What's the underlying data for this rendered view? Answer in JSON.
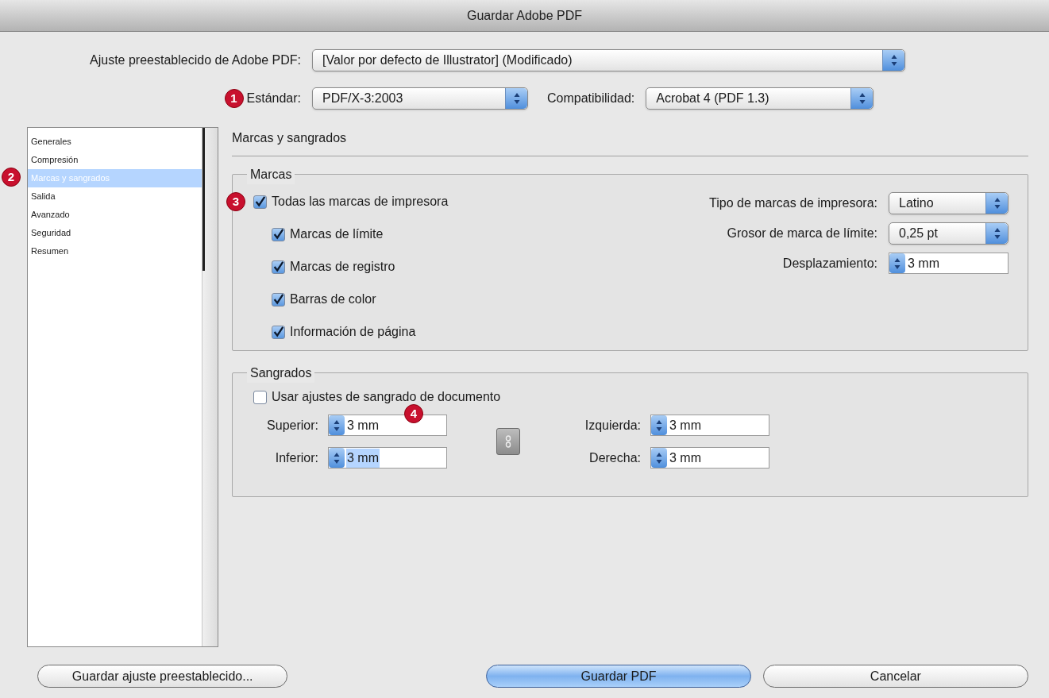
{
  "window": {
    "title": "Guardar Adobe PDF"
  },
  "preset": {
    "label": "Ajuste preestablecido de Adobe PDF:",
    "value": "[Valor por defecto de Illustrator] (Modificado)"
  },
  "standard": {
    "callout": "1",
    "label": "Estándar:",
    "value": "PDF/X-3:2003"
  },
  "compatibility": {
    "label": "Compatibilidad:",
    "value": "Acrobat 4 (PDF 1.3)"
  },
  "sidebar": {
    "callout": "2",
    "items": [
      {
        "label": "Generales",
        "selected": false
      },
      {
        "label": "Compresión",
        "selected": false
      },
      {
        "label": "Marcas y sangrados",
        "selected": true
      },
      {
        "label": "Salida",
        "selected": false
      },
      {
        "label": "Avanzado",
        "selected": false
      },
      {
        "label": "Seguridad",
        "selected": false
      },
      {
        "label": "Resumen",
        "selected": false
      }
    ]
  },
  "section_title": "Marcas y sangrados",
  "marks": {
    "title": "Marcas",
    "all": {
      "label": "Todas las marcas de impresora",
      "checked": true,
      "callout": "3"
    },
    "checkboxes": [
      {
        "label": "Marcas de límite",
        "checked": true
      },
      {
        "label": "Marcas de registro",
        "checked": true
      },
      {
        "label": "Barras de color",
        "checked": true
      },
      {
        "label": "Información de página",
        "checked": true
      }
    ],
    "settings": [
      {
        "kind": "select",
        "label": "Tipo de marcas de impresora:",
        "value": "Latino"
      },
      {
        "kind": "select",
        "label": "Grosor de marca de límite:",
        "value": "0,25 pt"
      },
      {
        "kind": "stepper",
        "label": "Desplazamiento:",
        "value": "3 mm"
      }
    ]
  },
  "bleeds": {
    "title": "Sangrados",
    "use_document": {
      "label": "Usar ajustes de sangrado de documento",
      "checked": false
    },
    "fields": [
      {
        "label": "Superior:",
        "value": "3 mm",
        "callout": "4",
        "highlighted": false
      },
      {
        "label": "Inferior:",
        "value": "3 mm",
        "highlighted": true
      },
      {
        "label": "Izquierda:",
        "value": "3 mm",
        "highlighted": false
      },
      {
        "label": "Derecha:",
        "value": "3 mm",
        "highlighted": false
      }
    ]
  },
  "buttons": [
    {
      "label": "Guardar ajuste preestablecido...",
      "default": false
    },
    {
      "label": "Guardar PDF",
      "default": true
    },
    {
      "label": "Cancelar",
      "default": false
    }
  ]
}
